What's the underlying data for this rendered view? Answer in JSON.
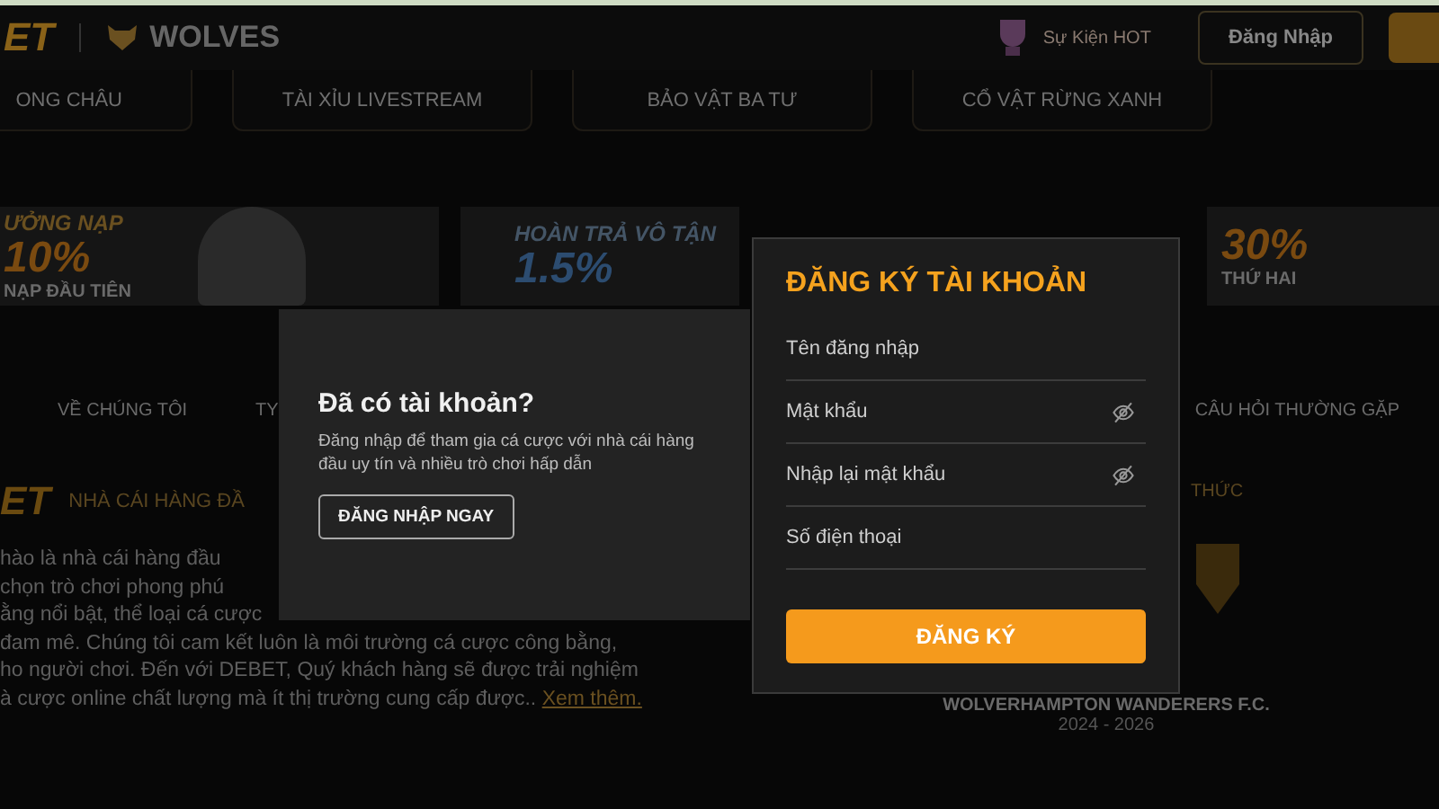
{
  "header": {
    "logo": "ET",
    "brand": "WOLVES",
    "event_link": "Sự Kiện HOT",
    "login_button": "Đăng Nhập"
  },
  "game_tabs": [
    "ONG CHÂU",
    "TÀI XỈU LIVESTREAM",
    "BẢO VẬT BA TƯ",
    "CỔ VẬT RỪNG XANH"
  ],
  "banners": [
    {
      "kind": "first",
      "title": "ƯỞNG NẠP",
      "big": "10%",
      "subtitle": "NẠP ĐẦU TIÊN"
    },
    {
      "kind": "cashback",
      "title": "HOÀN TRẢ VÔ TẬN",
      "big": "1.5%"
    },
    {
      "kind": "second",
      "big": "30%",
      "subtitle": "THỨ HAI"
    }
  ],
  "nav": [
    "VỀ CHÚNG TÔI",
    "TY",
    "CÂU HỎI THƯỜNG GẶP"
  ],
  "about": {
    "logo": "ET",
    "heading": "NHÀ CÁI HÀNG ĐẦ",
    "lines": [
      "hào là nhà cái hàng đầu",
      "chọn trò chơi phong phú",
      "ằng nổi bật, thể loại cá cược",
      "đam mê. Chúng tôi cam kết luôn là môi trường cá cược công bằng,",
      "ho người chơi. Đến với DEBET, Quý khách hàng sẽ được trải nghiệm",
      "à cược online chất lượng mà ít thị trường cung cấp được.."
    ],
    "more_link": "Xem thêm.",
    "side_heading": "THỨC",
    "club": "WOLVERHAMPTON WANDERERS F.C.",
    "years": "2024 - 2026"
  },
  "login_panel": {
    "title": "Đã có tài khoản?",
    "text": "Đăng nhập để tham gia cá cược với nhà cái hàng đầu uy tín và nhiều trò chơi hấp dẫn",
    "button": "ĐĂNG NHẬP NGAY"
  },
  "register_panel": {
    "title": "ĐĂNG KÝ TÀI KHOẢN",
    "fields": [
      {
        "kind": "text",
        "placeholder": "Tên đăng nhập"
      },
      {
        "kind": "password",
        "placeholder": "Mật khẩu"
      },
      {
        "kind": "password",
        "placeholder": "Nhập lại mật khẩu"
      },
      {
        "kind": "text",
        "placeholder": "Số điện thoại"
      }
    ],
    "button": "ĐĂNG KÝ"
  }
}
